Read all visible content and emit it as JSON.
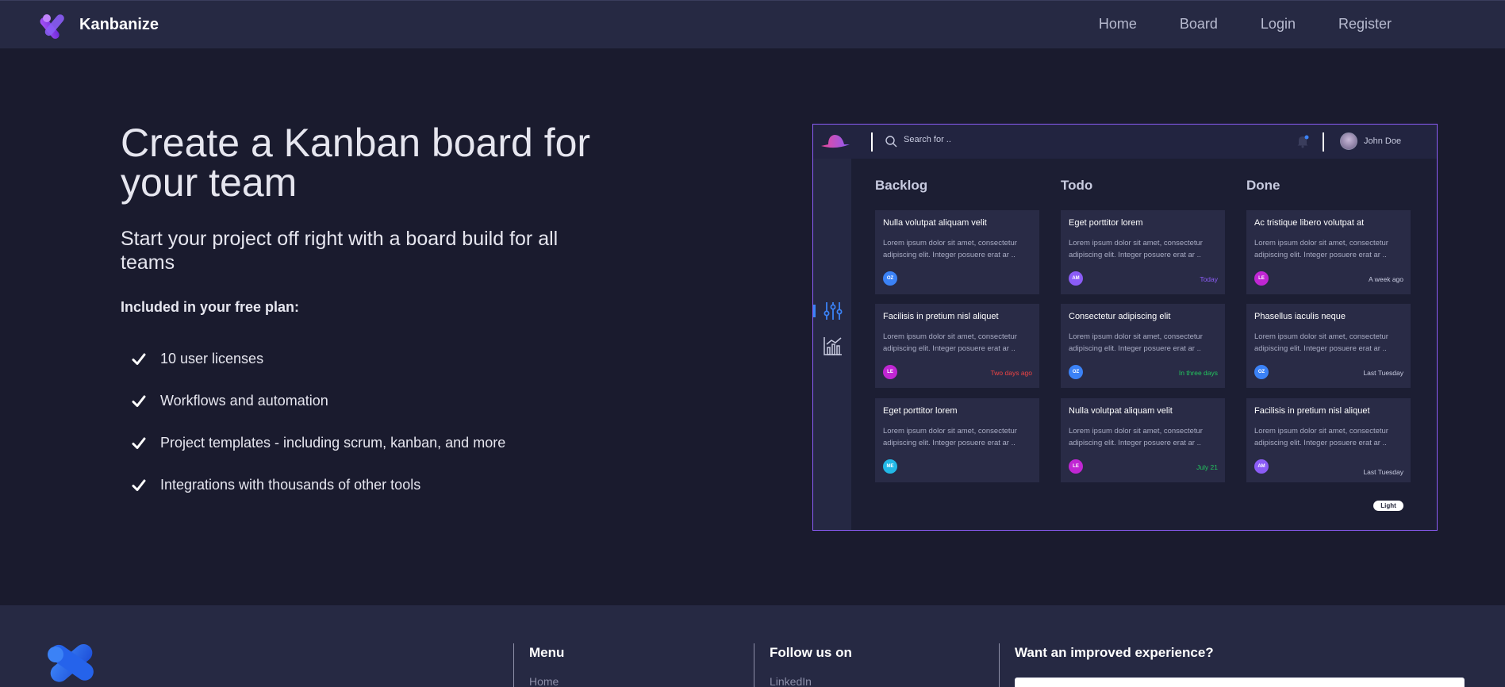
{
  "nav": {
    "brand": "Kanbanize",
    "links": [
      "Home",
      "Board",
      "Login",
      "Register"
    ]
  },
  "hero": {
    "title": "Create a Kanban board for your team",
    "subtitle": "Start your project off right with a board build for all teams",
    "plan_label": "Included in your free plan:",
    "features": [
      "10 user licenses",
      "Workflows and automation",
      "Project templates - including scrum, kanban, and more",
      "Integrations with thousands of other tools"
    ]
  },
  "preview": {
    "search_placeholder": "Search for ..",
    "user_name": "John Doe",
    "columns": [
      {
        "title": "Backlog",
        "cards": [
          {
            "title": "Nulla volutpat aliquam velit",
            "body": "Lorem ipsum dolor sit amet, consectetur adipiscing elit. Integer posuere erat ar ..",
            "avatar": "OZ",
            "avatar_color": "#3b82f6",
            "date": "",
            "date_color": "#a9acc4"
          },
          {
            "title": "Facilisis in pretium nisl aliquet",
            "body": "Lorem ipsum dolor sit amet, consectetur adipiscing elit. Integer posuere erat ar ..",
            "avatar": "LE",
            "avatar_color": "#c026d3",
            "date": "Two days ago",
            "date_color": "#ef4444"
          },
          {
            "title": "Eget porttitor lorem",
            "body": "Lorem ipsum dolor sit amet, consectetur adipiscing elit. Integer posuere erat ar ..",
            "avatar": "ME",
            "avatar_color": "#22b8e6",
            "date": "",
            "date_color": "#a9acc4"
          }
        ]
      },
      {
        "title": "Todo",
        "cards": [
          {
            "title": "Eget porttitor lorem",
            "body": "Lorem ipsum dolor sit amet, consectetur adipiscing elit. Integer posuere erat ar ..",
            "avatar": "AM",
            "avatar_color": "#8b5cf6",
            "date": "Today",
            "date_color": "#8b5cf6"
          },
          {
            "title": "Consectetur adipiscing elit",
            "body": "Lorem ipsum dolor sit amet, consectetur adipiscing elit. Integer posuere erat ar ..",
            "avatar": "OZ",
            "avatar_color": "#3b82f6",
            "date": "In three days",
            "date_color": "#22c55e"
          },
          {
            "title": "Nulla volutpat aliquam velit",
            "body": "Lorem ipsum dolor sit amet, consectetur adipiscing elit. Integer posuere erat ar ..",
            "avatar": "LE",
            "avatar_color": "#c026d3",
            "date": "July 21",
            "date_color": "#22c55e"
          }
        ]
      },
      {
        "title": "Done",
        "cards": [
          {
            "title": "Ac tristique libero volutpat at",
            "body": "Lorem ipsum dolor sit amet, consectetur adipiscing elit. Integer posuere erat ar ..",
            "avatar": "LE",
            "avatar_color": "#c026d3",
            "date": "A week ago",
            "date_color": "#c8cbe0"
          },
          {
            "title": "Phasellus iaculis neque",
            "body": "Lorem ipsum dolor sit amet, consectetur adipiscing elit. Integer posuere erat ar ..",
            "avatar": "OZ",
            "avatar_color": "#3b82f6",
            "date": "Last Tuesday",
            "date_color": "#c8cbe0"
          },
          {
            "title": "Facilisis in pretium nisl aliquet",
            "body": "Lorem ipsum dolor sit amet, consectetur adipiscing elit. Integer posuere erat ar ..",
            "avatar": "AM",
            "avatar_color": "#8b5cf6",
            "date": "Last Tuesday",
            "date_color": "#c8cbe0"
          }
        ]
      }
    ],
    "theme_toggle": "Light"
  },
  "footer": {
    "menu_heading": "Menu",
    "menu_first_link": "Home",
    "follow_heading": "Follow us on",
    "follow_first_link": "LinkedIn",
    "newsletter_heading": "Want an improved experience?"
  },
  "colors": {
    "background": "#1a1b2e",
    "navbar": "#262943",
    "accent": "#8b5cf6",
    "card": "#292b46"
  },
  "icons": [
    "brand-logo-icon",
    "check-icon",
    "search-icon",
    "bell-icon",
    "filters-icon",
    "chart-icon",
    "hat-logo-icon"
  ]
}
